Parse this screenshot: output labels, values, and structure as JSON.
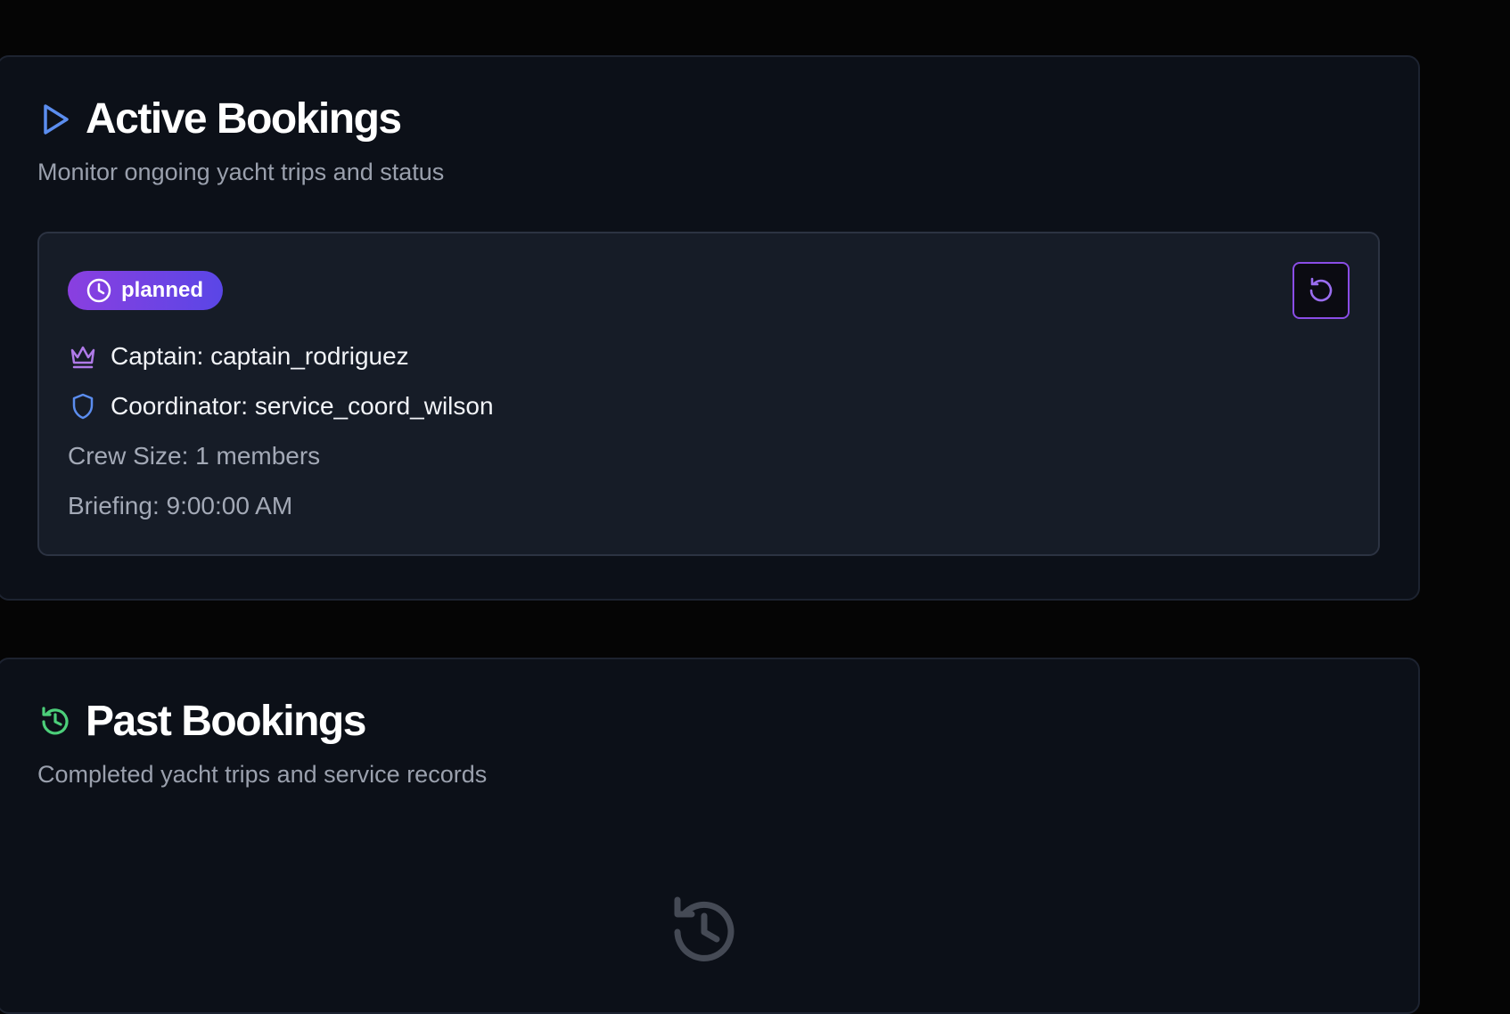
{
  "active_bookings": {
    "title": "Active Bookings",
    "subtitle": "Monitor ongoing yacht trips and status",
    "icon": "play-icon",
    "card": {
      "status": "planned",
      "status_icon": "clock-icon",
      "captain": "Captain: captain_rodriguez",
      "coordinator": "Coordinator: service_coord_wilson",
      "crew_size": "Crew Size: 1 members",
      "briefing": "Briefing: 9:00:00 AM",
      "refresh_icon": "rotate-ccw-icon"
    }
  },
  "past_bookings": {
    "title": "Past Bookings",
    "subtitle": "Completed yacht trips and service records",
    "icon": "history-icon",
    "empty_icon": "history-icon"
  },
  "colors": {
    "background": "#050505",
    "panel": "#0c1018",
    "card": "#161c27",
    "accent_blue": "#5b8def",
    "accent_purple": "#8a4de6",
    "accent_green": "#4ccf7a"
  }
}
